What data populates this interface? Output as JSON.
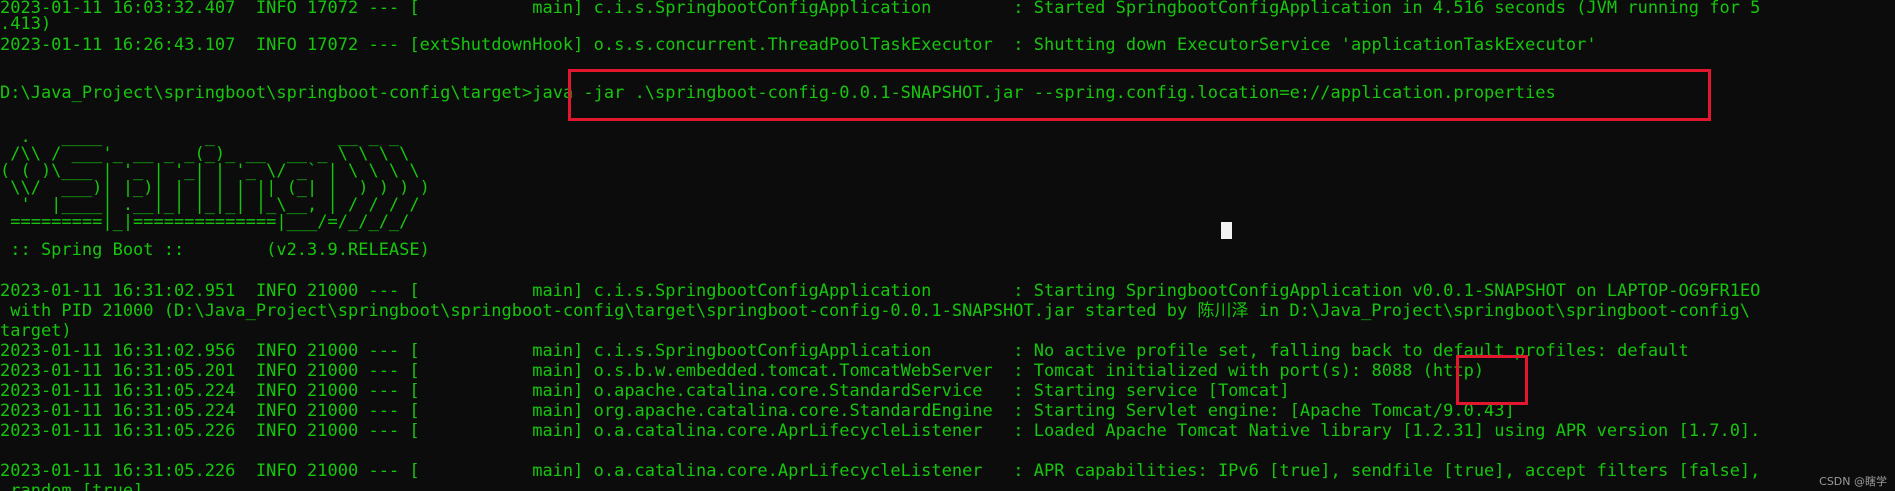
{
  "terminal": {
    "lines_top": [
      "2023-01-11 16:03:32.407  INFO 17072 --- [           main] c.i.s.SpringbootConfigApplication        : Started SpringbootConfigApplication in 4.516 seconds (JVM running for 5",
      ".413)",
      "2023-01-11 16:26:43.107  INFO 17072 --- [extShutdownHook] o.s.s.concurrent.ThreadPoolTaskExecutor  : Shutting down ExecutorService 'applicationTaskExecutor'"
    ],
    "prompt": "D:\\Java_Project\\springboot\\springboot-config\\target>",
    "command": "java -jar .\\springboot-config-0.0.1-SNAPSHOT.jar --spring.config.location=e://application.properties",
    "banner": [
      "  .   ____          _            __ _ _",
      " /\\\\ / ___'_ __ _ _(_)_ __  __ _ \\ \\ \\ \\",
      "( ( )\\___ | '_ | '_| | '_ \\/ _` | \\ \\ \\ \\",
      " \\\\/  ___)| |_)| | | | | || (_| |  ) ) ) )",
      "  '  |____| .__|_| |_|_| |_\\__, | / / / /",
      " =========|_|==============|___/=/_/_/_/"
    ],
    "boot_line": " :: Spring Boot ::        (v2.3.9.RELEASE)",
    "log_lines": [
      "2023-01-11 16:31:02.951  INFO 21000 --- [           main] c.i.s.SpringbootConfigApplication        : Starting SpringbootConfigApplication v0.0.1-SNAPSHOT on LAPTOP-OG9FR1EO",
      " with PID 21000 (D:\\Java_Project\\springboot\\springboot-config\\target\\springboot-config-0.0.1-SNAPSHOT.jar started by 陈川泽 in D:\\Java_Project\\springboot\\springboot-config\\",
      "target)",
      "2023-01-11 16:31:02.956  INFO 21000 --- [           main] c.i.s.SpringbootConfigApplication        : No active profile set, falling back to default profiles: default",
      "2023-01-11 16:31:05.201  INFO 21000 --- [           main] o.s.b.w.embedded.tomcat.TomcatWebServer  : Tomcat initialized with port(s): 8088 (http)",
      "2023-01-11 16:31:05.224  INFO 21000 --- [           main] o.apache.catalina.core.StandardService   : Starting service [Tomcat]",
      "2023-01-11 16:31:05.224  INFO 21000 --- [           main] org.apache.catalina.core.StandardEngine  : Starting Servlet engine: [Apache Tomcat/9.0.43]",
      "2023-01-11 16:31:05.226  INFO 21000 --- [           main] o.a.catalina.core.AprLifecycleListener   : Loaded Apache Tomcat Native library [1.2.31] using APR version [1.7.0].",
      "",
      "2023-01-11 16:31:05.226  INFO 21000 --- [           main] o.a.catalina.core.AprLifecycleListener   : APR capabilities: IPv6 [true], sendfile [true], accept filters [false],",
      " random [true]."
    ],
    "watermark": "CSDN @瞎学"
  },
  "colors": {
    "background": "#0c0c0c",
    "text": "#16c60c",
    "highlight_box": "#e2162c",
    "cursor": "#f2f2f2"
  }
}
